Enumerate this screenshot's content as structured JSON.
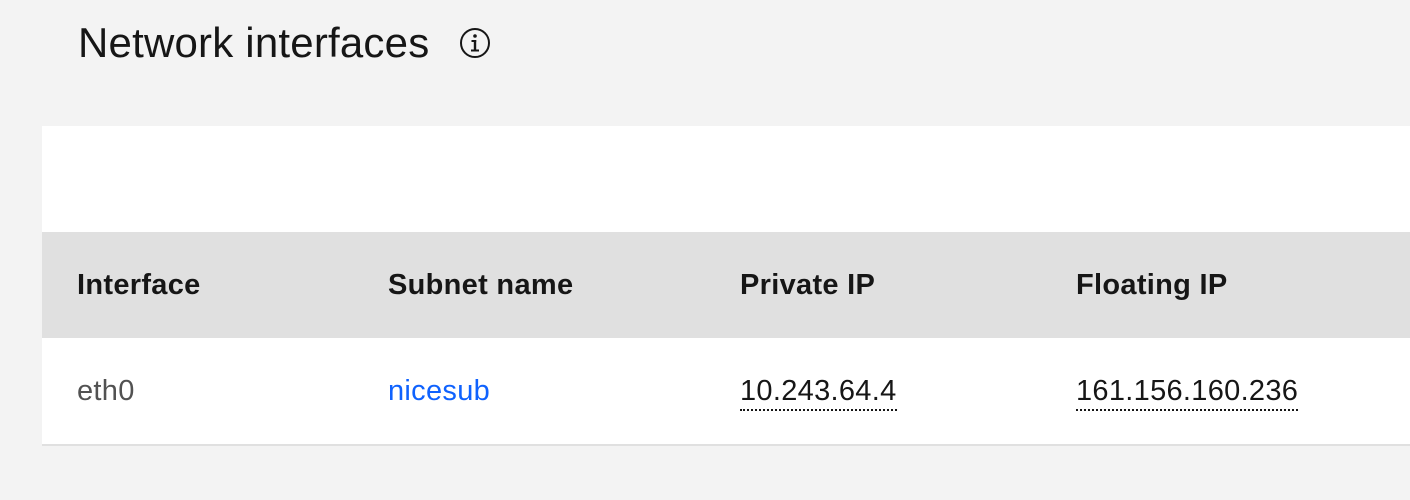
{
  "header": {
    "title": "Network interfaces",
    "info_icon": "info-circle-icon"
  },
  "table": {
    "columns": [
      "Interface",
      "Subnet name",
      "Private IP",
      "Floating IP"
    ],
    "rows": [
      {
        "interface": "eth0",
        "subnet_name": "nicesub",
        "private_ip": "10.243.64.4",
        "floating_ip": "161.156.160.236"
      }
    ]
  },
  "colors": {
    "page_background": "#f3f3f3",
    "header_row_background": "#e0e0e0",
    "link": "#0f62fe"
  }
}
